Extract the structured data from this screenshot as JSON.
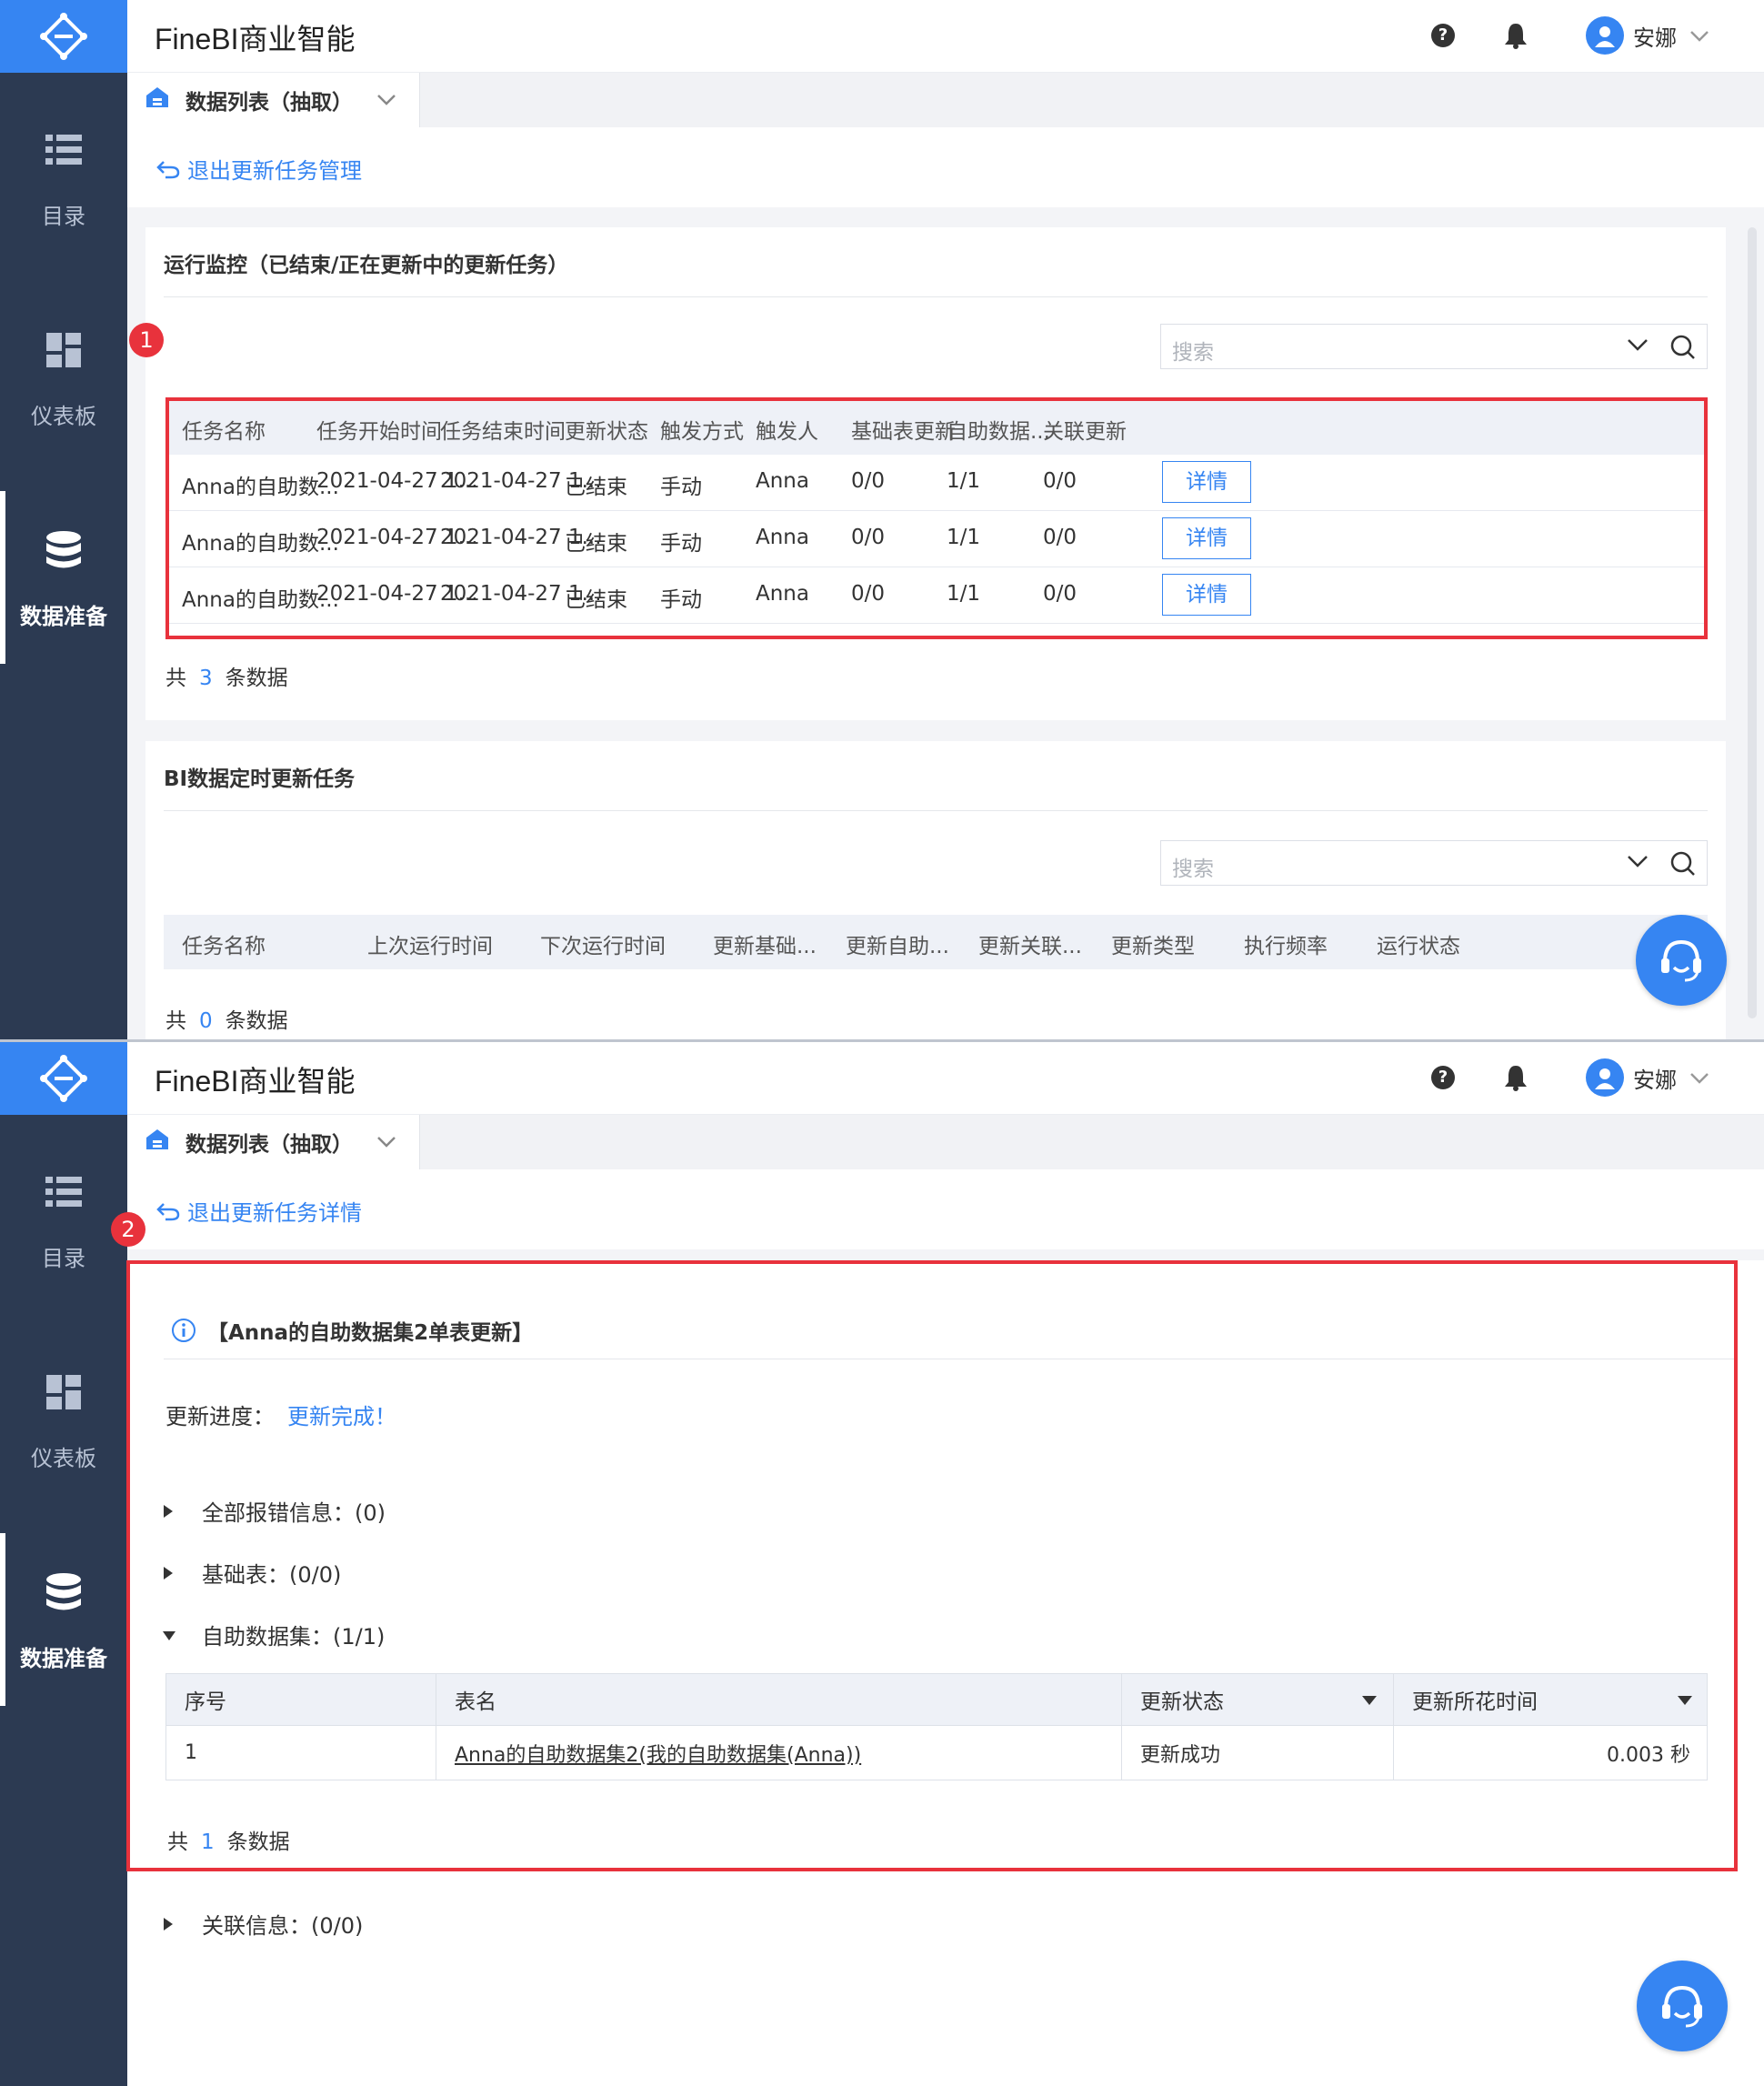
{
  "app_title": "FineBI商业智能",
  "user": {
    "name": "安娜"
  },
  "sidebar": [
    {
      "label": "目录",
      "icon": "list-icon"
    },
    {
      "label": "仪表板",
      "icon": "dashboard-icon"
    },
    {
      "label": "数据准备",
      "icon": "database-icon"
    }
  ],
  "tab": {
    "label": "数据列表（抽取）"
  },
  "shot1": {
    "back_link": "退出更新任务管理",
    "badge": "1",
    "monitor": {
      "title": "运行监控（已结束/正在更新中的更新任务）",
      "search_placeholder": "搜索",
      "columns": [
        "任务名称",
        "任务开始时间",
        "任务结束时间",
        "更新状态",
        "触发方式",
        "触发人",
        "基础表更新",
        "自助数据...",
        "关联更新"
      ],
      "rows": [
        [
          "Anna的自助数...",
          "2021-04-27 1...",
          "2021-04-27 1...",
          "已结束",
          "手动",
          "Anna",
          "0/0",
          "1/1",
          "0/0"
        ],
        [
          "Anna的自助数...",
          "2021-04-27 1...",
          "2021-04-27 1...",
          "已结束",
          "手动",
          "Anna",
          "0/0",
          "1/1",
          "0/0"
        ],
        [
          "Anna的自助数...",
          "2021-04-27 1...",
          "2021-04-27 1...",
          "已结束",
          "手动",
          "Anna",
          "0/0",
          "1/1",
          "0/0"
        ]
      ],
      "detail_label": "详情",
      "total_prefix": "共",
      "total_count": "3",
      "total_suffix": "条数据"
    },
    "scheduled": {
      "title": "BI数据定时更新任务",
      "search_placeholder": "搜索",
      "columns": [
        "任务名称",
        "上次运行时间",
        "下次运行时间",
        "更新基础...",
        "更新自助...",
        "更新关联...",
        "更新类型",
        "执行频率",
        "运行状态"
      ],
      "total_prefix": "共",
      "total_count": "0",
      "total_suffix": "条数据"
    }
  },
  "shot2": {
    "back_link": "退出更新任务详情",
    "badge": "2",
    "task_title": "【Anna的自助数据集2单表更新】",
    "progress_label": "更新进度：",
    "progress_value": "更新完成！",
    "sections": [
      {
        "label": "全部报错信息：(0)",
        "expanded": false
      },
      {
        "label": "基础表：(0/0)",
        "expanded": false
      },
      {
        "label": "自助数据集：(1/1)",
        "expanded": true
      }
    ],
    "table": {
      "columns": [
        "序号",
        "表名",
        "更新状态",
        "更新所花时间"
      ],
      "rows": [
        {
          "index": "1",
          "name": "Anna的自助数据集2(我的自助数据集(Anna))",
          "status": "更新成功",
          "time": "0.003 秒"
        }
      ]
    },
    "total_prefix": "共",
    "total_count": "1",
    "total_suffix": "条数据",
    "relation": {
      "label": "关联信息：(0/0)",
      "expanded": false
    }
  },
  "colors": {
    "accent": "#3685f2",
    "sidebar": "#2c3a52",
    "highlight": "#e8323c"
  }
}
